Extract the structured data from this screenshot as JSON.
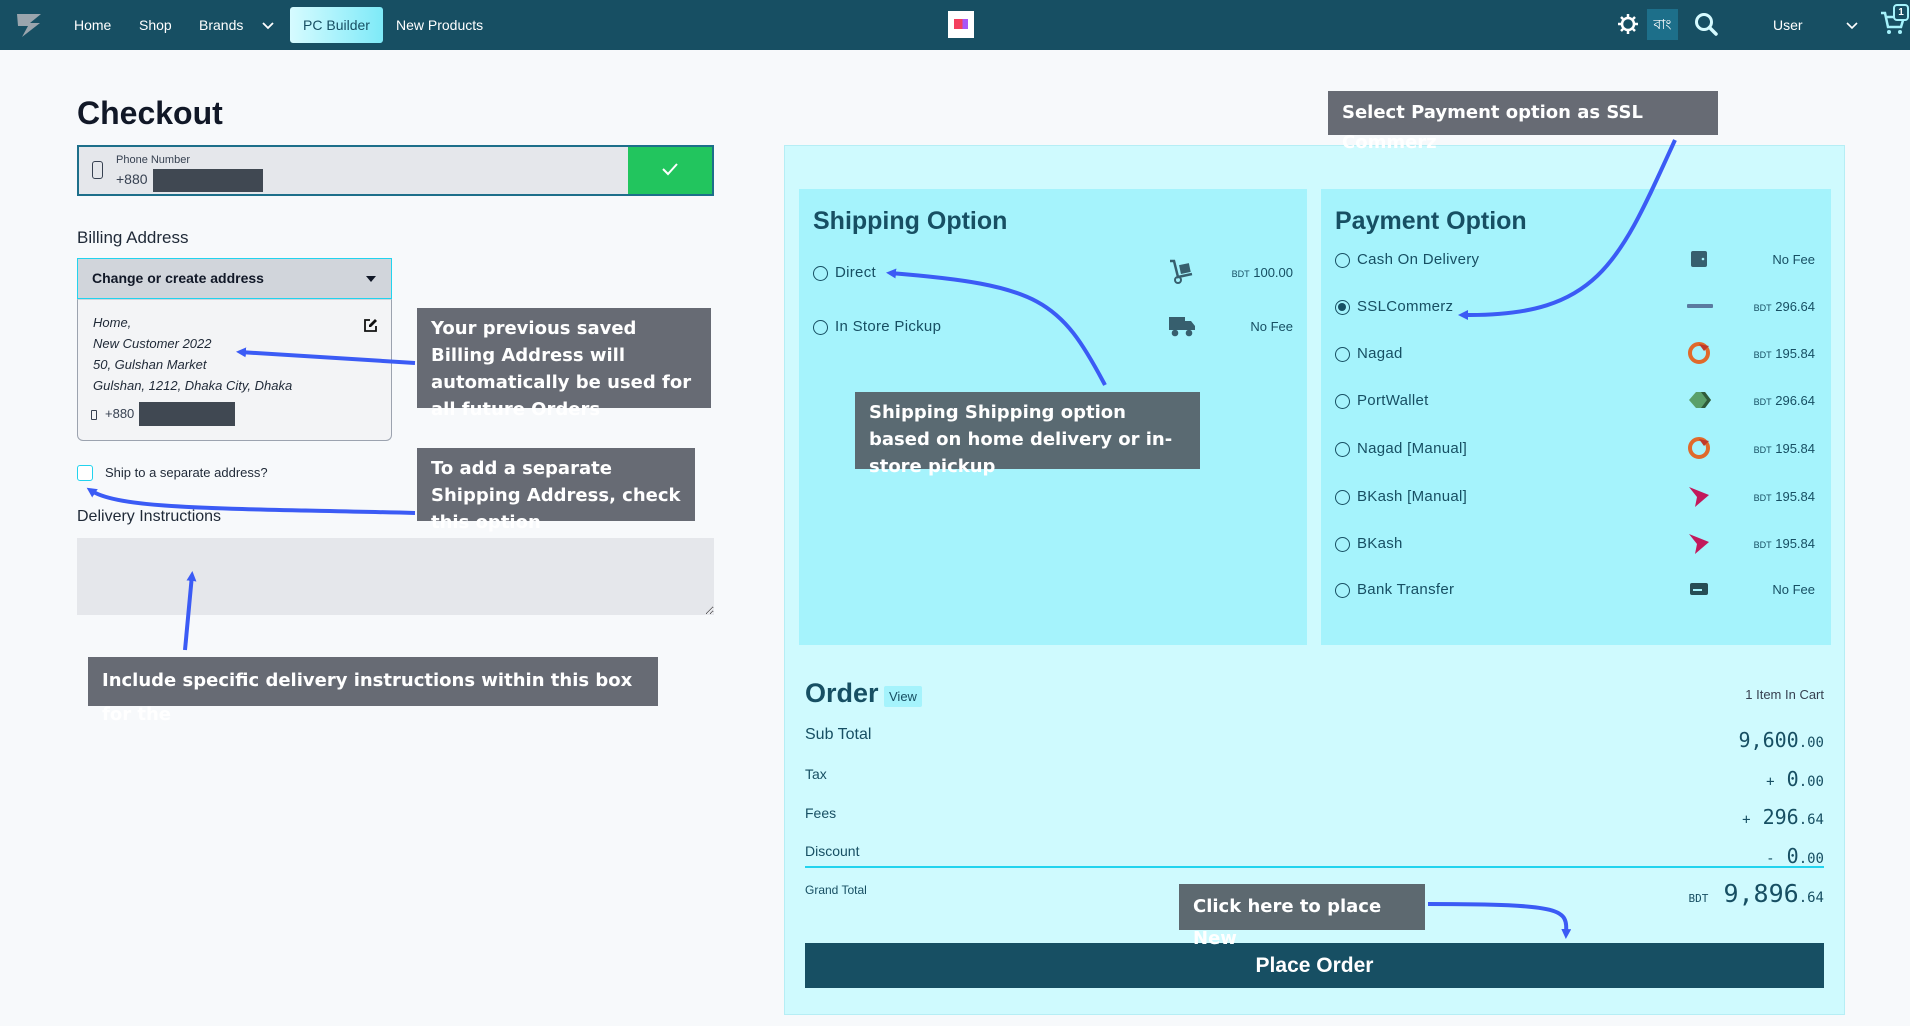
{
  "nav": {
    "items": [
      {
        "label": "Home"
      },
      {
        "label": "Shop"
      },
      {
        "label": "Brands"
      },
      {
        "label": "PC Builder",
        "active": true
      },
      {
        "label": "New Products"
      }
    ],
    "lang_label": "বাং",
    "user_label": "User",
    "cart_count": "1",
    "icons": [
      "logo-icon",
      "chevron-down-icon",
      "store-logo-icon",
      "theme-toggle-icon",
      "search-icon",
      "chevron-down-icon",
      "cart-icon"
    ]
  },
  "checkout": {
    "title": "Checkout",
    "phone": {
      "label": "Phone Number",
      "prefix": "+880",
      "masked": true
    },
    "billing_label": "Billing Address",
    "address_select": "Change or create address",
    "address": {
      "lines": [
        "Home,",
        "New Customer 2022",
        "50, Gulshan Market",
        "Gulshan, 1212, Dhaka City, Dhaka"
      ],
      "phone_prefix": "+880"
    },
    "ship_separate_label": "Ship to a separate address?",
    "ship_separate_checked": false,
    "delivery_label": "Delivery Instructions",
    "delivery_value": ""
  },
  "shipping": {
    "title": "Shipping Option",
    "options": [
      {
        "label": "Direct",
        "icon": "hand-truck-icon",
        "fee_prefix": "BDT",
        "fee": "100.00",
        "selected": false
      },
      {
        "label": "In Store Pickup",
        "icon": "truck-icon",
        "fee_prefix": "",
        "fee": "No Fee",
        "selected": false
      }
    ]
  },
  "payment": {
    "title": "Payment Option",
    "options": [
      {
        "label": "Cash On Delivery",
        "icon": "wallet-icon",
        "fee_prefix": "",
        "fee": "No Fee",
        "selected": false
      },
      {
        "label": "SSLCommerz",
        "icon": "sslcommerz-icon",
        "fee_prefix": "BDT",
        "fee": "296.64",
        "selected": true
      },
      {
        "label": "Nagad",
        "icon": "nagad-icon",
        "fee_prefix": "BDT",
        "fee": "195.84",
        "selected": false
      },
      {
        "label": "PortWallet",
        "icon": "portwallet-icon",
        "fee_prefix": "BDT",
        "fee": "296.64",
        "selected": false
      },
      {
        "label": "Nagad [Manual]",
        "icon": "nagad-icon",
        "fee_prefix": "BDT",
        "fee": "195.84",
        "selected": false
      },
      {
        "label": "BKash [Manual]",
        "icon": "bkash-icon",
        "fee_prefix": "BDT",
        "fee": "195.84",
        "selected": false
      },
      {
        "label": "BKash",
        "icon": "bkash-icon",
        "fee_prefix": "BDT",
        "fee": "195.84",
        "selected": false
      },
      {
        "label": "Bank Transfer",
        "icon": "bank-card-icon",
        "fee_prefix": "",
        "fee": "No Fee",
        "selected": false
      }
    ]
  },
  "order": {
    "title": "Order",
    "view_label": "View",
    "items_in_cart": "1 Item In Cart",
    "rows": [
      {
        "label": "Sub Total",
        "sign": "",
        "whole": "9,600",
        "cents": ".00"
      },
      {
        "label": "Tax",
        "sign": "+",
        "whole": "0",
        "cents": ".00"
      },
      {
        "label": "Fees",
        "sign": "+",
        "whole": "296",
        "cents": ".64"
      },
      {
        "label": "Discount",
        "sign": "-",
        "whole": "0",
        "cents": ".00"
      }
    ],
    "grand_total": {
      "label": "Grand Total",
      "currency": "BDT",
      "whole": "9,896",
      "cents": ".64"
    },
    "place_order_label": "Place Order"
  },
  "annotations": {
    "payment": "Select Payment option as SSL Commerz",
    "billing": "Your previous saved Billing Address will automatically be used for all future Orders",
    "separate": "To add a separate Shipping Address, check this option",
    "shipping": "Shipping Shipping option based on home delivery or in-store pickup",
    "delivery": "Include specific delivery instructions within this box for the",
    "place": "Click here to place New",
    "arrow_color": "#3b5bf5"
  },
  "colors": {
    "nav_bg": "#174f63",
    "accent": "#22d3ee",
    "panel_bg": "#cffafe",
    "option_box_bg": "#a5f3fc",
    "success": "#22c55e",
    "annotation_bg": "#676b74"
  }
}
